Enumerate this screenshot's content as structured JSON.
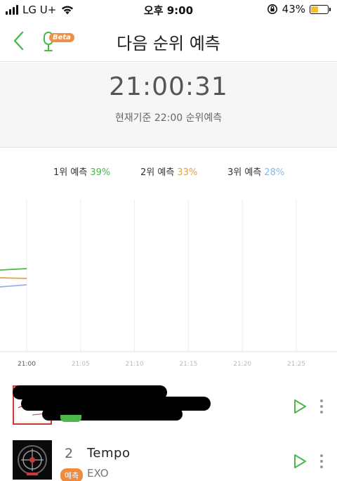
{
  "status_bar": {
    "carrier": "LG U+",
    "time": "오후 9:00",
    "battery_percent": "43%",
    "battery_level": 0.43,
    "signal_bars": 4
  },
  "nav": {
    "title": "다음 순위 예측",
    "beta_badge": "Beta",
    "back_icon": "chevron-left-icon",
    "mic_icon": "microphone-icon"
  },
  "countdown": {
    "time": "21:00:31",
    "subtitle": "현재기준 22:00 순위예측"
  },
  "legend": [
    {
      "label": "1위 예측",
      "value": "39%",
      "color": "#4cb84a"
    },
    {
      "label": "2위 예측",
      "value": "33%",
      "color": "#e0a24a"
    },
    {
      "label": "3위 예측",
      "value": "28%",
      "color": "#8cb8e6"
    }
  ],
  "chart_data": {
    "type": "line",
    "x_ticks": [
      "21:00",
      "21:05",
      "21:10",
      "21:15",
      "21:20",
      "21:25"
    ],
    "series": [
      {
        "name": "1위 예측",
        "color": "#4cb84a"
      },
      {
        "name": "2위 예측",
        "color": "#e0a24a"
      },
      {
        "name": "3위 예측",
        "color": "#8cb8e6"
      }
    ],
    "grid": true
  },
  "songs": [
    {
      "rank": "",
      "title": "",
      "artist": "",
      "badge": "",
      "redacted": true
    },
    {
      "rank": "2",
      "title": "Tempo",
      "artist": "EXO",
      "badge": "예측",
      "redacted": false
    }
  ],
  "colors": {
    "accent_green": "#4cb84a",
    "badge_orange": "#f08a3c"
  }
}
